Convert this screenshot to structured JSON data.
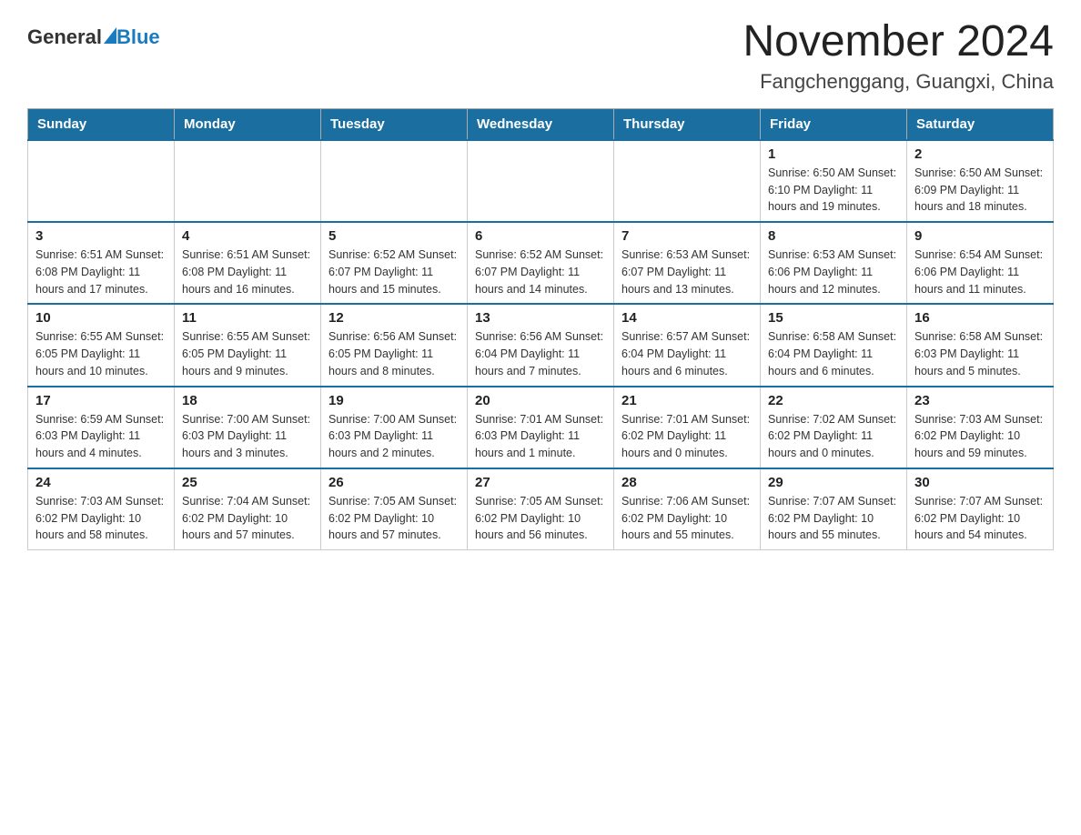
{
  "header": {
    "logo_general": "General",
    "logo_blue": "Blue",
    "month_title": "November 2024",
    "location": "Fangchenggang, Guangxi, China"
  },
  "weekdays": [
    "Sunday",
    "Monday",
    "Tuesday",
    "Wednesday",
    "Thursday",
    "Friday",
    "Saturday"
  ],
  "weeks": [
    [
      {
        "day": "",
        "info": ""
      },
      {
        "day": "",
        "info": ""
      },
      {
        "day": "",
        "info": ""
      },
      {
        "day": "",
        "info": ""
      },
      {
        "day": "",
        "info": ""
      },
      {
        "day": "1",
        "info": "Sunrise: 6:50 AM\nSunset: 6:10 PM\nDaylight: 11 hours and 19 minutes."
      },
      {
        "day": "2",
        "info": "Sunrise: 6:50 AM\nSunset: 6:09 PM\nDaylight: 11 hours and 18 minutes."
      }
    ],
    [
      {
        "day": "3",
        "info": "Sunrise: 6:51 AM\nSunset: 6:08 PM\nDaylight: 11 hours and 17 minutes."
      },
      {
        "day": "4",
        "info": "Sunrise: 6:51 AM\nSunset: 6:08 PM\nDaylight: 11 hours and 16 minutes."
      },
      {
        "day": "5",
        "info": "Sunrise: 6:52 AM\nSunset: 6:07 PM\nDaylight: 11 hours and 15 minutes."
      },
      {
        "day": "6",
        "info": "Sunrise: 6:52 AM\nSunset: 6:07 PM\nDaylight: 11 hours and 14 minutes."
      },
      {
        "day": "7",
        "info": "Sunrise: 6:53 AM\nSunset: 6:07 PM\nDaylight: 11 hours and 13 minutes."
      },
      {
        "day": "8",
        "info": "Sunrise: 6:53 AM\nSunset: 6:06 PM\nDaylight: 11 hours and 12 minutes."
      },
      {
        "day": "9",
        "info": "Sunrise: 6:54 AM\nSunset: 6:06 PM\nDaylight: 11 hours and 11 minutes."
      }
    ],
    [
      {
        "day": "10",
        "info": "Sunrise: 6:55 AM\nSunset: 6:05 PM\nDaylight: 11 hours and 10 minutes."
      },
      {
        "day": "11",
        "info": "Sunrise: 6:55 AM\nSunset: 6:05 PM\nDaylight: 11 hours and 9 minutes."
      },
      {
        "day": "12",
        "info": "Sunrise: 6:56 AM\nSunset: 6:05 PM\nDaylight: 11 hours and 8 minutes."
      },
      {
        "day": "13",
        "info": "Sunrise: 6:56 AM\nSunset: 6:04 PM\nDaylight: 11 hours and 7 minutes."
      },
      {
        "day": "14",
        "info": "Sunrise: 6:57 AM\nSunset: 6:04 PM\nDaylight: 11 hours and 6 minutes."
      },
      {
        "day": "15",
        "info": "Sunrise: 6:58 AM\nSunset: 6:04 PM\nDaylight: 11 hours and 6 minutes."
      },
      {
        "day": "16",
        "info": "Sunrise: 6:58 AM\nSunset: 6:03 PM\nDaylight: 11 hours and 5 minutes."
      }
    ],
    [
      {
        "day": "17",
        "info": "Sunrise: 6:59 AM\nSunset: 6:03 PM\nDaylight: 11 hours and 4 minutes."
      },
      {
        "day": "18",
        "info": "Sunrise: 7:00 AM\nSunset: 6:03 PM\nDaylight: 11 hours and 3 minutes."
      },
      {
        "day": "19",
        "info": "Sunrise: 7:00 AM\nSunset: 6:03 PM\nDaylight: 11 hours and 2 minutes."
      },
      {
        "day": "20",
        "info": "Sunrise: 7:01 AM\nSunset: 6:03 PM\nDaylight: 11 hours and 1 minute."
      },
      {
        "day": "21",
        "info": "Sunrise: 7:01 AM\nSunset: 6:02 PM\nDaylight: 11 hours and 0 minutes."
      },
      {
        "day": "22",
        "info": "Sunrise: 7:02 AM\nSunset: 6:02 PM\nDaylight: 11 hours and 0 minutes."
      },
      {
        "day": "23",
        "info": "Sunrise: 7:03 AM\nSunset: 6:02 PM\nDaylight: 10 hours and 59 minutes."
      }
    ],
    [
      {
        "day": "24",
        "info": "Sunrise: 7:03 AM\nSunset: 6:02 PM\nDaylight: 10 hours and 58 minutes."
      },
      {
        "day": "25",
        "info": "Sunrise: 7:04 AM\nSunset: 6:02 PM\nDaylight: 10 hours and 57 minutes."
      },
      {
        "day": "26",
        "info": "Sunrise: 7:05 AM\nSunset: 6:02 PM\nDaylight: 10 hours and 57 minutes."
      },
      {
        "day": "27",
        "info": "Sunrise: 7:05 AM\nSunset: 6:02 PM\nDaylight: 10 hours and 56 minutes."
      },
      {
        "day": "28",
        "info": "Sunrise: 7:06 AM\nSunset: 6:02 PM\nDaylight: 10 hours and 55 minutes."
      },
      {
        "day": "29",
        "info": "Sunrise: 7:07 AM\nSunset: 6:02 PM\nDaylight: 10 hours and 55 minutes."
      },
      {
        "day": "30",
        "info": "Sunrise: 7:07 AM\nSunset: 6:02 PM\nDaylight: 10 hours and 54 minutes."
      }
    ]
  ]
}
